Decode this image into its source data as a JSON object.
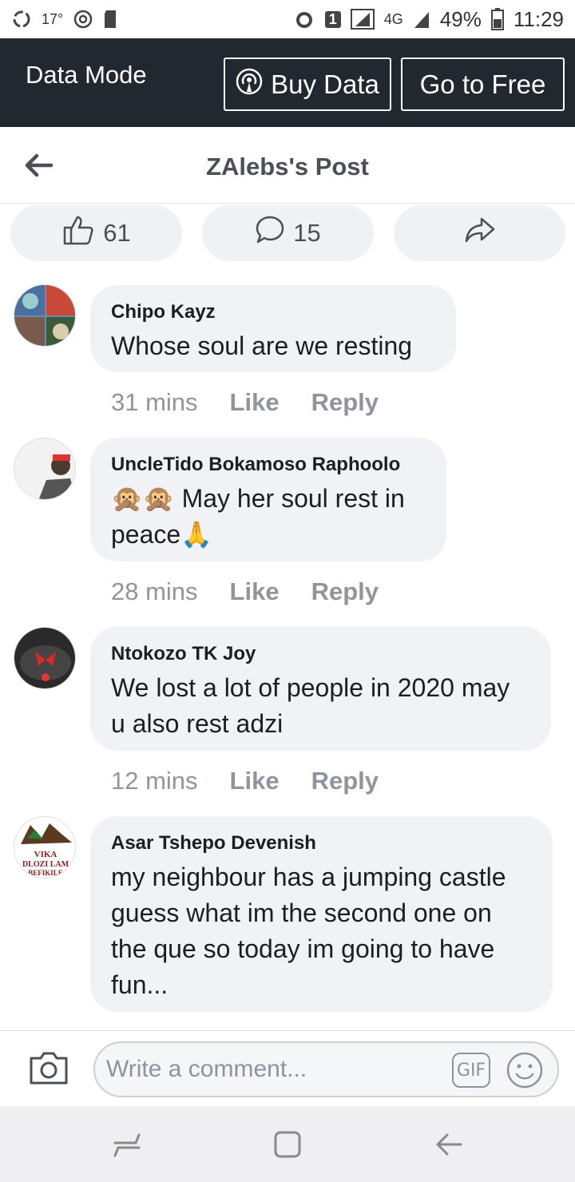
{
  "status_bar": {
    "temperature": "17°",
    "network": "4G",
    "sim": "1",
    "battery": "49%",
    "time": "11:29"
  },
  "data_mode": {
    "title": "Data Mode",
    "buy_label": "Buy Data",
    "free_label": "Go to Free"
  },
  "header": {
    "title": "ZAlebs's Post"
  },
  "reactions": {
    "likes": "61",
    "comments": "15"
  },
  "comments": [
    {
      "name": "Chipo Kayz",
      "lines": [
        "Whose soul are we resting"
      ],
      "time": "31 mins",
      "like": "Like",
      "reply": "Reply"
    },
    {
      "name": "UncleTido Bokamoso Raphoolo",
      "emoji_prefix": "🙊🙊",
      "lines": [
        "May her soul rest in",
        "peace🙏"
      ],
      "time": "28 mins",
      "like": "Like",
      "reply": "Reply"
    },
    {
      "name": "Ntokozo TK Joy",
      "lines": [
        "We lost a lot of people in 2020 may",
        "u also rest adzi"
      ],
      "time": "12 mins",
      "like": "Like",
      "reply": "Reply"
    },
    {
      "name": "Asar Tshepo Devenish",
      "lines": [
        "my neighbour has a jumping castle",
        "guess what im the second one on",
        "the que so today im going to have",
        "fun..."
      ],
      "avatar_text": [
        "VIKA",
        "DLOZI LAM",
        "BEFIKILE"
      ]
    }
  ],
  "composer": {
    "placeholder": "Write a comment...",
    "gif": "GIF"
  },
  "colors": {
    "data_bar": "#222830",
    "bubble": "#f0f2f5",
    "meta": "#90949c",
    "pill": "#f0f1f4"
  }
}
